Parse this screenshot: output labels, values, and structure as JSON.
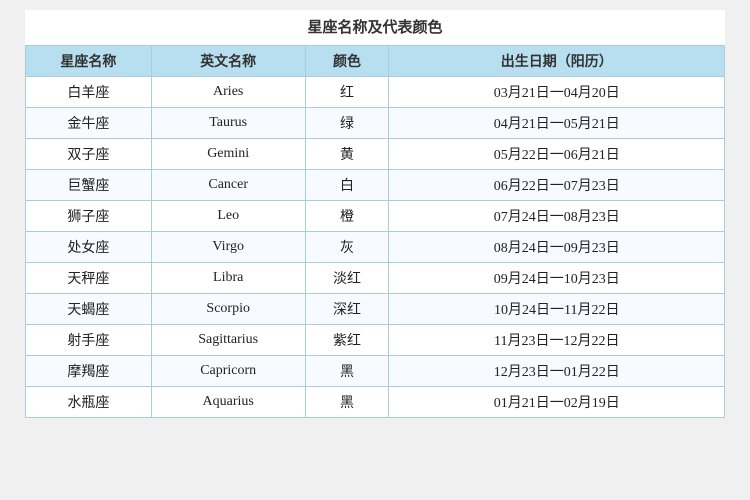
{
  "title": "星座名称及代表颜色",
  "headers": {
    "zh_name": "星座名称",
    "en_name": "英文名称",
    "color": "颜色",
    "date": "出生日期（阳历）"
  },
  "rows": [
    {
      "zh": "白羊座",
      "en": "Aries",
      "color": "红",
      "date": "03月21日一04月20日"
    },
    {
      "zh": "金牛座",
      "en": "Taurus",
      "color": "绿",
      "date": "04月21日一05月21日"
    },
    {
      "zh": "双子座",
      "en": "Gemini",
      "color": "黄",
      "date": "05月22日一06月21日"
    },
    {
      "zh": "巨蟹座",
      "en": "Cancer",
      "color": "白",
      "date": "06月22日一07月23日"
    },
    {
      "zh": "狮子座",
      "en": "Leo",
      "color": "橙",
      "date": "07月24日一08月23日"
    },
    {
      "zh": "处女座",
      "en": "Virgo",
      "color": "灰",
      "date": "08月24日一09月23日"
    },
    {
      "zh": "天秤座",
      "en": "Libra",
      "color": "淡红",
      "date": "09月24日一10月23日"
    },
    {
      "zh": "天蝎座",
      "en": "Scorpio",
      "color": "深红",
      "date": "10月24日一11月22日"
    },
    {
      "zh": "射手座",
      "en": "Sagittarius",
      "color": "紫红",
      "date": "11月23日一12月22日"
    },
    {
      "zh": "摩羯座",
      "en": "Capricorn",
      "color": "黑",
      "date": "12月23日一01月22日"
    },
    {
      "zh": "水瓶座",
      "en": "Aquarius",
      "color": "黑",
      "date": "01月21日一02月19日"
    }
  ]
}
